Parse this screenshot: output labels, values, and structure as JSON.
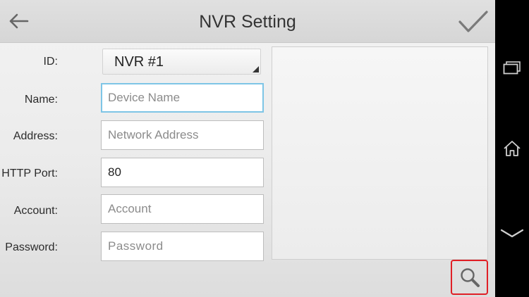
{
  "header": {
    "title": "NVR Setting",
    "back_icon": "arrow-left-icon",
    "confirm_icon": "checkmark-icon"
  },
  "form": {
    "id": {
      "label": "ID:",
      "value": "NVR #1"
    },
    "name": {
      "label": "Name:",
      "placeholder": "Device Name",
      "value": ""
    },
    "address": {
      "label": "Address:",
      "placeholder": "Network Address",
      "value": ""
    },
    "http_port": {
      "label": "HTTP Port:",
      "placeholder": "",
      "value": "80"
    },
    "account": {
      "label": "Account:",
      "placeholder": "Account",
      "value": ""
    },
    "password": {
      "label": "Password:",
      "placeholder": "Password",
      "value": ""
    }
  },
  "actions": {
    "search_icon": "magnifier-icon",
    "search_highlight_color": "#e01f26"
  },
  "system_nav": {
    "items": [
      "recent-apps-icon",
      "home-icon",
      "back-chevron-icon"
    ]
  },
  "colors": {
    "focus_border": "#7ec5e6",
    "title_bar": "#d9d9d9",
    "nav_bar": "#000000"
  }
}
